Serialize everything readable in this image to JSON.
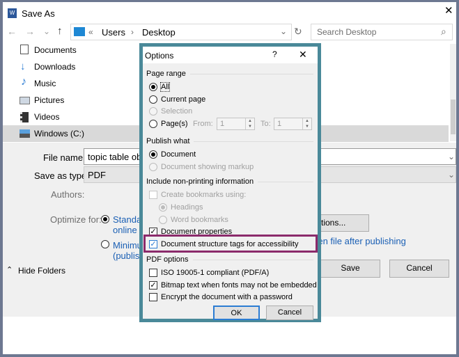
{
  "window": {
    "title": "Save As",
    "app_icon": "word-icon",
    "close": "✕"
  },
  "nav": {
    "back": "←",
    "forward": "→",
    "recent": "⌄",
    "up": "↑",
    "path_prefix": "«",
    "crumbs": [
      "Users",
      "Desktop"
    ],
    "separator": "›",
    "dropdown": "⌄",
    "refresh": "↻",
    "search_placeholder": "Search Desktop",
    "search_icon": "⌕"
  },
  "sidebar": {
    "items": [
      {
        "label": "Documents",
        "icon": "documents-icon"
      },
      {
        "label": "Downloads",
        "icon": "downloads-icon"
      },
      {
        "label": "Music",
        "icon": "music-icon"
      },
      {
        "label": "Pictures",
        "icon": "pictures-icon"
      },
      {
        "label": "Videos",
        "icon": "videos-icon"
      },
      {
        "label": "Windows (C:)",
        "icon": "drive-icon",
        "selected": true
      }
    ]
  },
  "form": {
    "file_name_label": "File name:",
    "file_name_value": "topic table obj",
    "save_type_label": "Save as type:",
    "save_type_value": "PDF",
    "authors_label": "Authors:",
    "optimize_label": "Optimize for:",
    "opt_standard": "Standard (publishing",
    "opt_standard_2": "online and printing)",
    "opt_minimum": "Minimum size",
    "opt_minimum_2": "(publishing online)",
    "options_button": "Options...",
    "open_after": "Open file after publishing",
    "hide_folders": "Hide Folders",
    "save": "Save",
    "cancel": "Cancel"
  },
  "dialog": {
    "title": "Options",
    "help": "?",
    "close": "✕",
    "accent": "#4a8999",
    "highlight": "#8b2a6b",
    "page_range": "Page range",
    "all": "All",
    "current_page": "Current page",
    "selection": "Selection",
    "pages": "Page(s)",
    "from_label": "From:",
    "from_value": "1",
    "to_label": "To:",
    "to_value": "1",
    "publish_what": "Publish what",
    "document": "Document",
    "document_markup": "Document showing markup",
    "non_printing": "Include non-printing information",
    "create_bookmarks": "Create bookmarks using:",
    "headings": "Headings",
    "word_bookmarks": "Word bookmarks",
    "doc_properties": "Document properties",
    "structure_tags": "Document structure tags for accessibility",
    "pdf_options": "PDF options",
    "iso": "ISO 19005-1 compliant (PDF/A)",
    "bitmap": "Bitmap text when fonts may not be embedded",
    "encrypt": "Encrypt the document with a password",
    "ok": "OK",
    "cancel": "Cancel"
  }
}
